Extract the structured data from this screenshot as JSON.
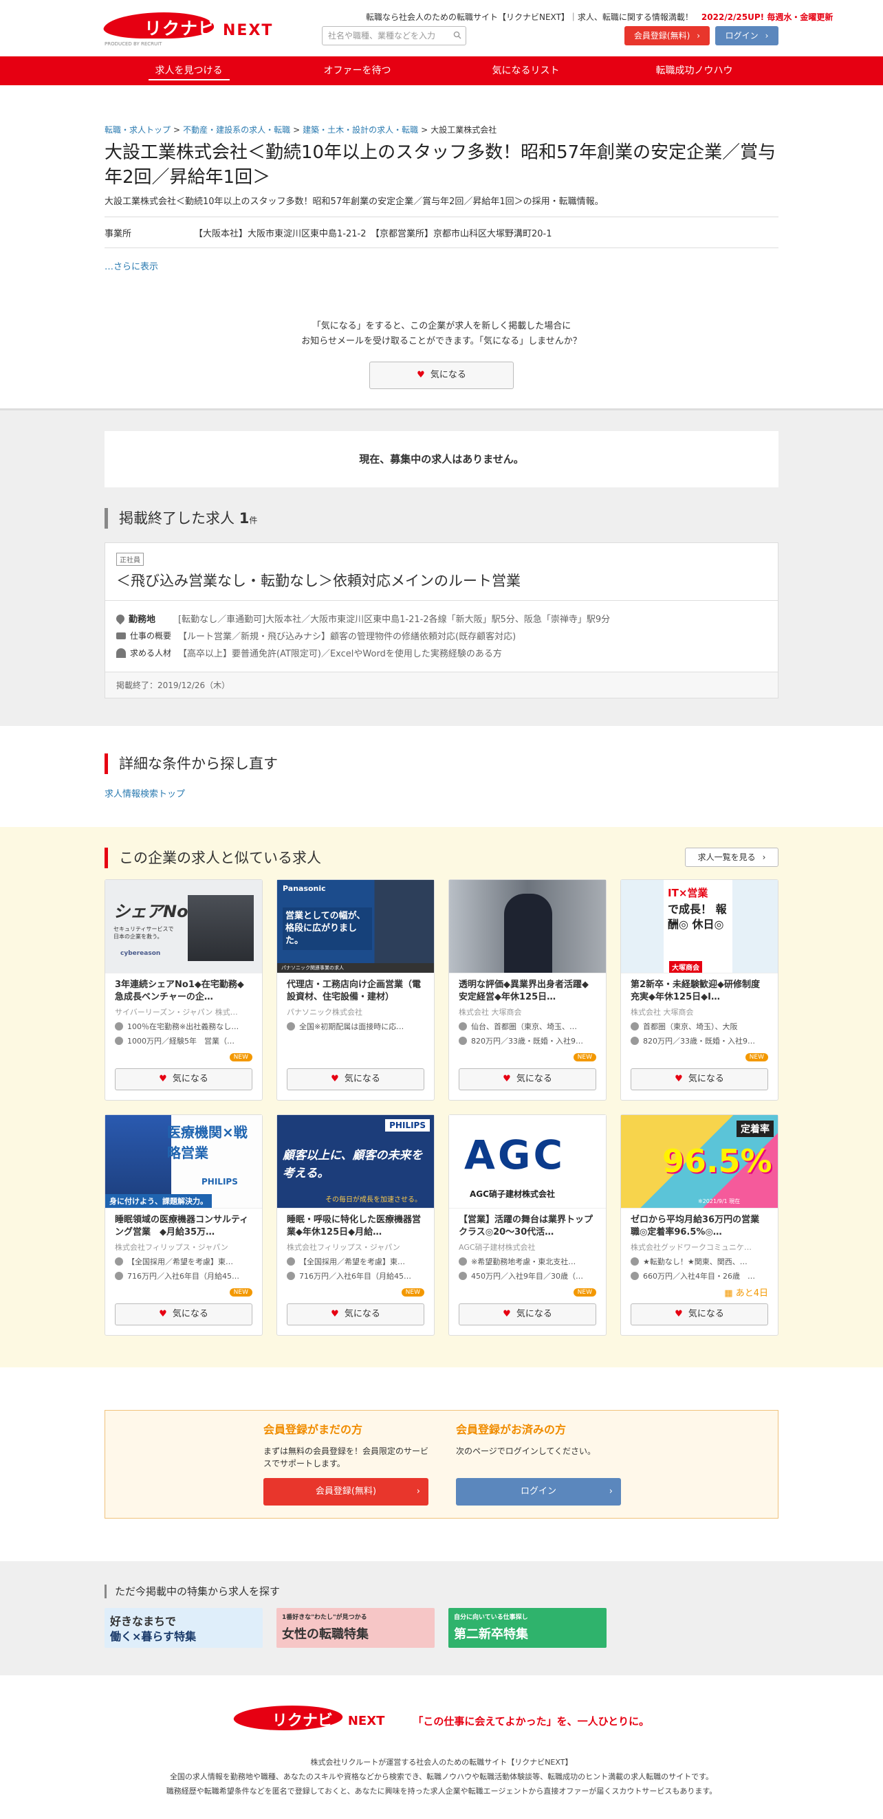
{
  "header": {
    "logo_main": "リクナビ",
    "logo_next": "NEXT",
    "logo_by": "PRODUCED BY RECRUIT",
    "tagline": "転職なら社会人のための転職サイト【リクナビNEXT】｜求人、転職に関する情報満載！",
    "tagline_update": "2022/2/25UP! 毎週水・金曜更新",
    "search_placeholder": "社名や職種、業種などを入力",
    "register_label": "会員登録(無料)",
    "login_label": "ログイン"
  },
  "nav": [
    "求人を見つける",
    "オファーを待つ",
    "気になるリスト",
    "転職成功ノウハウ"
  ],
  "breadcrumb": [
    "転職・求人トップ",
    "不動産・建設系の求人・転職",
    "建築・土木・設計の求人・転職",
    "大設工業株式会社"
  ],
  "company": {
    "title": "大設工業株式会社＜勤続10年以上のスタッフ多数！昭和57年創業の安定企業／賞与年2回／昇給年1回＞",
    "subtitle": "大設工業株式会社＜勤続10年以上のスタッフ多数！昭和57年創業の安定企業／賞与年2回／昇給年1回＞の採用・転職情報。",
    "office_label": "事業所",
    "office_value": "【大阪本社】大阪市東淀川区東中島1-21-2　【京都営業所】京都市山科区大塚野溝町20-1",
    "more": "…さらに表示"
  },
  "favorite": {
    "line1": "「気になる」をすると、この企業が求人を新しく掲載した場合に",
    "line2": "お知らせメールを受け取ることができます。「気になる」しませんか？",
    "button": "気になる"
  },
  "no_jobs": "現在、募集中の求人はありません。",
  "ended": {
    "heading": "掲載終了した求人",
    "count": "1",
    "count_unit": "件",
    "tag": "正社員",
    "title": "＜飛び込み営業なし・転勤なし＞依頼対応メインのルート営業",
    "loc_label": "勤務地",
    "loc_value": "[転勤なし／車通勤可]大阪本社／大阪市東淀川区東中島1-21-2各線「新大阪」駅5分、阪急「崇禅寺」駅9分",
    "job_label": "仕事の概要",
    "job_value": "【ルート営業／新規・飛び込みナシ】顧客の管理物件の修繕依頼対応(既存顧客対応)",
    "req_label": "求める人材",
    "req_value": "【高卒以上】要普通免許(AT限定可)／ExcelやWordを使用した実務経験のある方",
    "end_date": "掲載終了：2019/12/26（木）"
  },
  "again": {
    "heading": "詳細な条件から探し直す",
    "link": "求人情報検索トップ"
  },
  "similar": {
    "heading": "この企業の求人と似ている求人",
    "list_button": "求人一覧を見る",
    "fav_label": "気になる",
    "new_label": "NEW",
    "cards": [
      {
        "img_text": "シェアNo.1",
        "img_sub": "セキュリティサービスで日本の企業を救う。",
        "img_brand": "cybereason",
        "title": "3年連続シェアNo1◆在宅勤務◆急成長ベンチャーの企…",
        "company": "サイバーリーズン・ジャパン 株式…",
        "l1": "100％在宅勤務※出社義務なし…",
        "l2": "1000万円／経験5年　営業（…",
        "badge": "new"
      },
      {
        "img_text": "Panasonic",
        "img_sub": "営業としての幅が、格段に広がりました。",
        "img_brand": "パナソニック関連事業の求人",
        "title": "代理店・工務店向け企画営業（電設資材、住宅設備・建材）",
        "company": "パナソニック株式会社",
        "l1": "全国※初期配属は面接時に応…",
        "l2": "",
        "badge": ""
      },
      {
        "img_text": "",
        "img_sub": "",
        "img_brand": "",
        "title": "透明な評価◆異業界出身者活躍◆安定経営◆年休125日…",
        "company": "株式会社 大塚商会",
        "l1": "仙台、首都圏（東京、埼玉、…",
        "l2": "820万円／33歳・既婚・入社9…",
        "badge": "new"
      },
      {
        "img_text": "IT×営業",
        "img_sub": "で成長！ 報酬◎ 休日◎",
        "img_brand": "大塚商会",
        "title": "第2新卒・未経験歓迎◆研修制度充実◆年休125日◆I…",
        "company": "株式会社 大塚商会",
        "l1": "首都圏（東京、埼玉）、大阪",
        "l2": "820万円／33歳・既婚・入社9…",
        "badge": "new"
      },
      {
        "img_text": "医療機関×戦略営業",
        "img_sub": "身に付けよう、課題解決力。",
        "img_brand": "PHILIPS",
        "title": "睡眠領域の医療機器コンサルティング営業　◆月給35万…",
        "company": "株式会社フィリップス・ジャパン",
        "l1": "【全国採用／希望を考慮】東…",
        "l2": "716万円／入社6年目（月給45…",
        "badge": "new"
      },
      {
        "img_text": "顧客以上に、顧客の未来を考える。",
        "img_sub": "その毎日が成長を加速させる。",
        "img_brand": "PHILIPS",
        "title": "睡眠・呼吸に特化した医療機器営業◆年休125日◆月給…",
        "company": "株式会社フィリップス・ジャパン",
        "l1": "【全国採用／希望を考慮】東…",
        "l2": "716万円／入社6年目（月給45…",
        "badge": "new"
      },
      {
        "img_text": "AGC",
        "img_sub": "AGC硝子建材株式会社",
        "img_brand": "",
        "title": "【営業】活躍の舞台は業界トップクラス◎20～30代活…",
        "company": "AGC硝子建材株式会社",
        "l1": "※希望勤務地考慮・東北支社…",
        "l2": "450万円／入社9年目／30歳（…",
        "badge": "new"
      },
      {
        "img_text": "96.5%",
        "img_sub": "定着率",
        "img_brand": "※2021/9/1 現在",
        "title": "ゼロから平均月給36万円の営業職◎定着率96.5%◎…",
        "company": "株式会社グッドワークコミュニケ…",
        "l1": "★転勤なし！★関東、関西、…",
        "l2": "660万円／入社4年目・26歳　…",
        "badge": "left",
        "left_text": "あと4日"
      }
    ]
  },
  "member": {
    "h1": "会員登録がまだの方",
    "p1": "まずは無料の会員登録を！会員限定のサービスでサポートします。",
    "b1": "会員登録(無料)",
    "h2": "会員登録がお済みの方",
    "p2": "次のページでログインしてください。",
    "b2": "ログイン"
  },
  "features": {
    "heading": "ただ今掲載中の特集から求人を探す",
    "banners": [
      {
        "line1": "好きなまちで",
        "line2": "働く×暮らす特集",
        "bg": "#dfeefa"
      },
      {
        "line1": "1番好きな\"わたし\"が見つかる",
        "line2": "女性の転職特集",
        "bg": "#f6c6c6"
      },
      {
        "line1": "自分に向いている仕事探し",
        "line2": "第二新卒特集",
        "bg": "#2fb36c"
      }
    ]
  },
  "footer": {
    "slogan": "「この仕事に会えてよかった」を、一人ひとりに。",
    "t1": "株式会社リクルートが運営する社会人のための転職サイト【リクナビNEXT】",
    "t2": "全国の求人情報を勤務地や職種、あなたのスキルや資格などから検索でき、転職ノウハウや転職活動体験談等、転職成功のヒント満載の求人転職のサイトです。",
    "t3": "職務経歴や転職希望条件などを匿名で登録しておくと、あなたに興味を持った求人企業や転職エージェントから直接オファーが届くスカウトサービスもあります。"
  }
}
